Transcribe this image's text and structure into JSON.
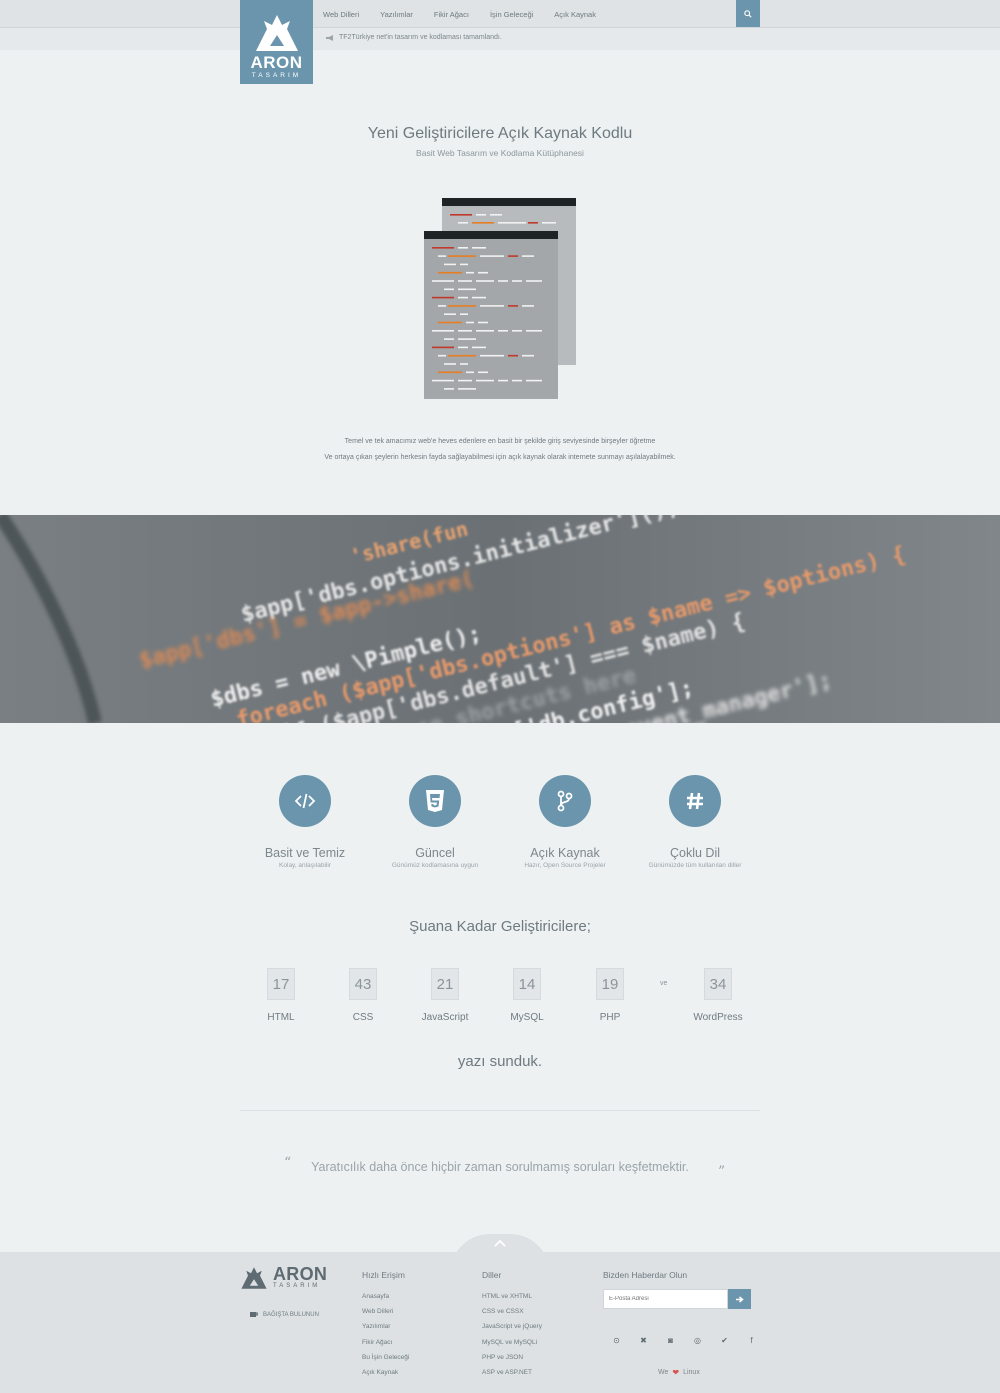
{
  "brand": {
    "name": "ARON",
    "sub": "TASARIM"
  },
  "nav": [
    "Web Dilleri",
    "Yazılımlar",
    "Fikir Ağacı",
    "İşin Geleceği",
    "Açık Kaynak"
  ],
  "ticker": "TF2Türkiye net'in tasarım ve kodlaması tamamlandı.",
  "hero": {
    "title": "Yeni Geliştiricilere Açık Kaynak Kodlu",
    "subtitle": "Basit Web Tasarım ve Kodlama Kütüphanesi",
    "intro_line1": "Temel ve tek amacımız web'e heves edenlere en basit bir şekilde giriş seviyesinde birşeyler öğretme",
    "intro_line2": "Ve ortaya çıkan şeylerin herkesin fayda sağlayabilmesi için açık kaynak olarak internete sunmayı aşılalayabilmek."
  },
  "code_band": {
    "lines": [
      "'share(fun",
      "$app['dbs.options.initializer']();",
      "$app['dbs'] = $app->share(",
      "$dbs = new \\Pimple();",
      "foreach ($app['dbs.options'] as $name => $options) {",
      "if ($app['dbs.default'] === $name) {",
      "// we use shortcuts here",
      "$config = $app['db.config'];",
      "$manager = $app['db.event_manager'];"
    ]
  },
  "features": [
    {
      "icon": "code-icon",
      "title": "Basit ve Temiz",
      "desc": "Kolay, anlaşılabilir"
    },
    {
      "icon": "css3-icon",
      "title": "Güncel",
      "desc": "Günümüz kodlamasına uygun"
    },
    {
      "icon": "git-branch-icon",
      "title": "Açık Kaynak",
      "desc": "Hazır, Open Source Projeler"
    },
    {
      "icon": "hashtag-icon",
      "title": "Çoklu Dil",
      "desc": "Günümüzde tüm kullanılan diller"
    }
  ],
  "stats": {
    "title": "Şuana Kadar Geliştiricilere;",
    "items": [
      {
        "num": "17",
        "label": "HTML"
      },
      {
        "num": "43",
        "label": "CSS"
      },
      {
        "num": "21",
        "label": "JavaScript"
      },
      {
        "num": "14",
        "label": "MySQL"
      },
      {
        "num": "19",
        "label": "PHP"
      },
      {
        "num": "34",
        "label": "WordPress"
      }
    ],
    "connector": "ve",
    "outro": "yazı sunduk."
  },
  "quote": {
    "open": "“",
    "text": "Yaratıcılık daha önce hiçbir zaman sorulmamış soruları keşfetmektir.",
    "close": "”"
  },
  "footer": {
    "donate": "BAĞIŞTA BULUNUN",
    "quick_title": "Hızlı Erişim",
    "quick_links": [
      "Anasayfa",
      "Web Dilleri",
      "Yazılımlar",
      "Fikir Ağacı",
      "Bu İşin Geleceği",
      "Açık Kaynak"
    ],
    "lang_title": "Diller",
    "lang_links": [
      "HTML ve XHTML",
      "CSS ve CSSX",
      "JavaScript ve jQuery",
      "MySQL ve MySQLi",
      "PHP ve JSON",
      "ASP ve ASP.NET"
    ],
    "newsletter_title": "Bizden Haberdar Olun",
    "newsletter_placeholder": "E-Posta Adresi",
    "socials": [
      "github-icon",
      "joomla-icon",
      "steam-icon",
      "dribbble-icon",
      "twitter-icon",
      "facebook-icon"
    ],
    "we": "We",
    "linux": "Linux"
  },
  "colors": {
    "accent": "#6a95ad",
    "background": "#eef1f2",
    "footer": "#dde1e3"
  }
}
